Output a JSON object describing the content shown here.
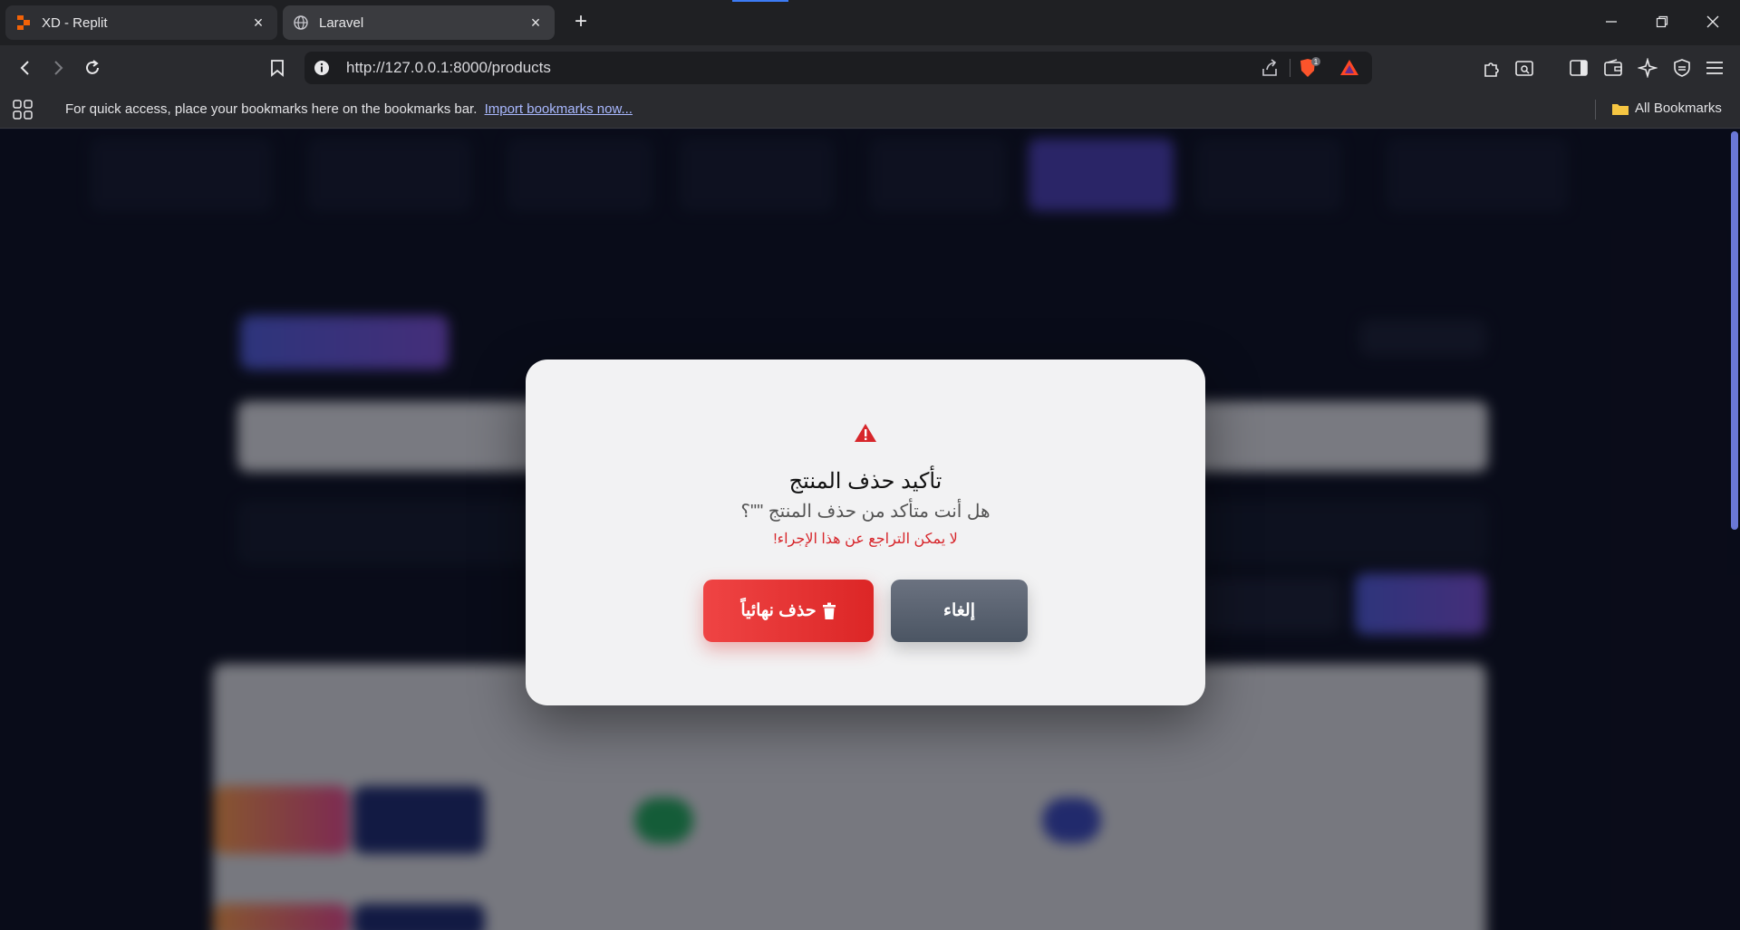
{
  "browser": {
    "tabs": [
      {
        "title": "XD - Replit",
        "active": false
      },
      {
        "title": "Laravel",
        "active": true
      }
    ],
    "url": "http://127.0.0.1:8000/products",
    "brave_badge": "1",
    "bookmarks_bar": {
      "message": "For quick access, place your bookmarks here on the bookmarks bar.",
      "import_link": "Import bookmarks now...",
      "all_bookmarks": "All Bookmarks"
    }
  },
  "modal": {
    "title": "تأكيد حذف المنتج",
    "message": "هل أنت متأكد من حذف المنتج \"\"؟",
    "warning": "لا يمكن التراجع عن هذا الإجراء!",
    "delete_label": "حذف نهائياً",
    "cancel_label": "إلغاء"
  },
  "colors": {
    "danger": "#dc2626",
    "cancel": "#4b5563",
    "modal_bg": "#f2f2f3",
    "accent": "#6a77d6"
  }
}
